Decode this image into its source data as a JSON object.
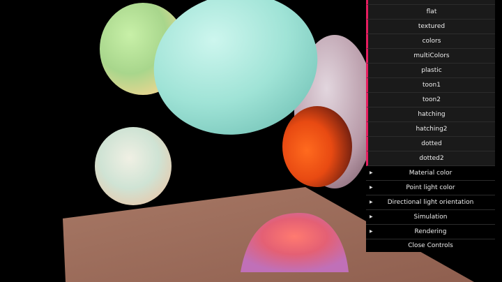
{
  "gui": {
    "material_options": [
      "flat",
      "textured",
      "colors",
      "multiColors",
      "plastic",
      "toon1",
      "toon2",
      "hatching",
      "hatching2",
      "dotted",
      "dotted2"
    ],
    "folders": [
      "Material color",
      "Point light color",
      "Directional light orientation",
      "Simulation",
      "Rendering"
    ],
    "close_label": "Close Controls"
  },
  "colors": {
    "accent": "#e61d5f",
    "panel_bg": "#1a1a1a",
    "plane": "#9a6a58",
    "background": "#000000"
  }
}
